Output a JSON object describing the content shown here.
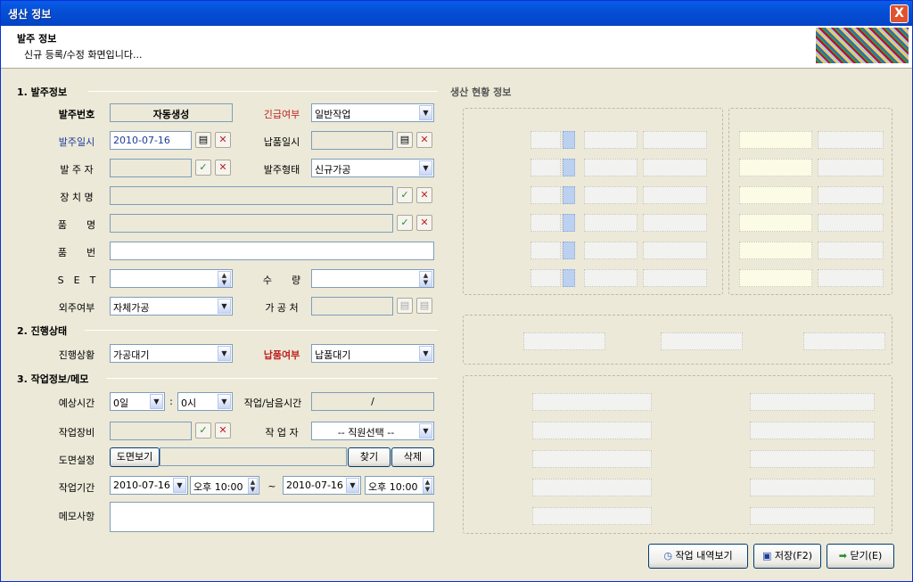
{
  "window": {
    "title": "생산 정보",
    "close": "X"
  },
  "header": {
    "title": "발주 정보",
    "subtitle": "신규 등록/수정 화면입니다..."
  },
  "sections": {
    "order": "1. 발주정보",
    "progress": "2. 진행상태",
    "work": "3. 작업정보/메모",
    "right": "생산 현황 정보"
  },
  "order": {
    "order_no_label": "발주번호",
    "order_no_value": "자동생성",
    "urgent_label": "긴급여부",
    "urgent_value": "일반작업",
    "order_date_label": "발주일시",
    "order_date_value": "2010-07-16",
    "delivery_date_label": "납품일시",
    "delivery_date_value": "",
    "orderer_label": "발 주 자",
    "orderer_value": "",
    "order_type_label": "발주형태",
    "order_type_value": "신규가공",
    "device_label": "장 치 명",
    "product_label": "품　　명",
    "part_no_label": "품　　번",
    "set_label": "S　E　T",
    "qty_label": "수　　량",
    "outsource_label": "외주여부",
    "outsource_value": "자체가공",
    "processor_label": "가 공 처"
  },
  "progress": {
    "status_label": "진행상황",
    "status_value": "가공대기",
    "delivery_label": "납품여부",
    "delivery_value": "납품대기"
  },
  "work": {
    "est_label": "예상시간",
    "days_value": "0일",
    "hours_value": "0시",
    "remain_label": "작업/남음시간",
    "remain_value": "/",
    "equip_label": "작업장비",
    "worker_label": "작 업 자",
    "worker_value": "-- 직원선택 --",
    "drawing_label": "도면설정",
    "drawing_view": "도면보기",
    "find": "찾기",
    "delete": "삭제",
    "period_label": "작업기간",
    "start_date": "2010-07-16",
    "start_time": "오후 10:00",
    "tilde": "~",
    "end_date": "2010-07-16",
    "end_time": "오후 10:00",
    "memo_label": "메모사항"
  },
  "footer": {
    "history": "작업 내역보기",
    "save": "저장(F2)",
    "close": "닫기(E)"
  }
}
